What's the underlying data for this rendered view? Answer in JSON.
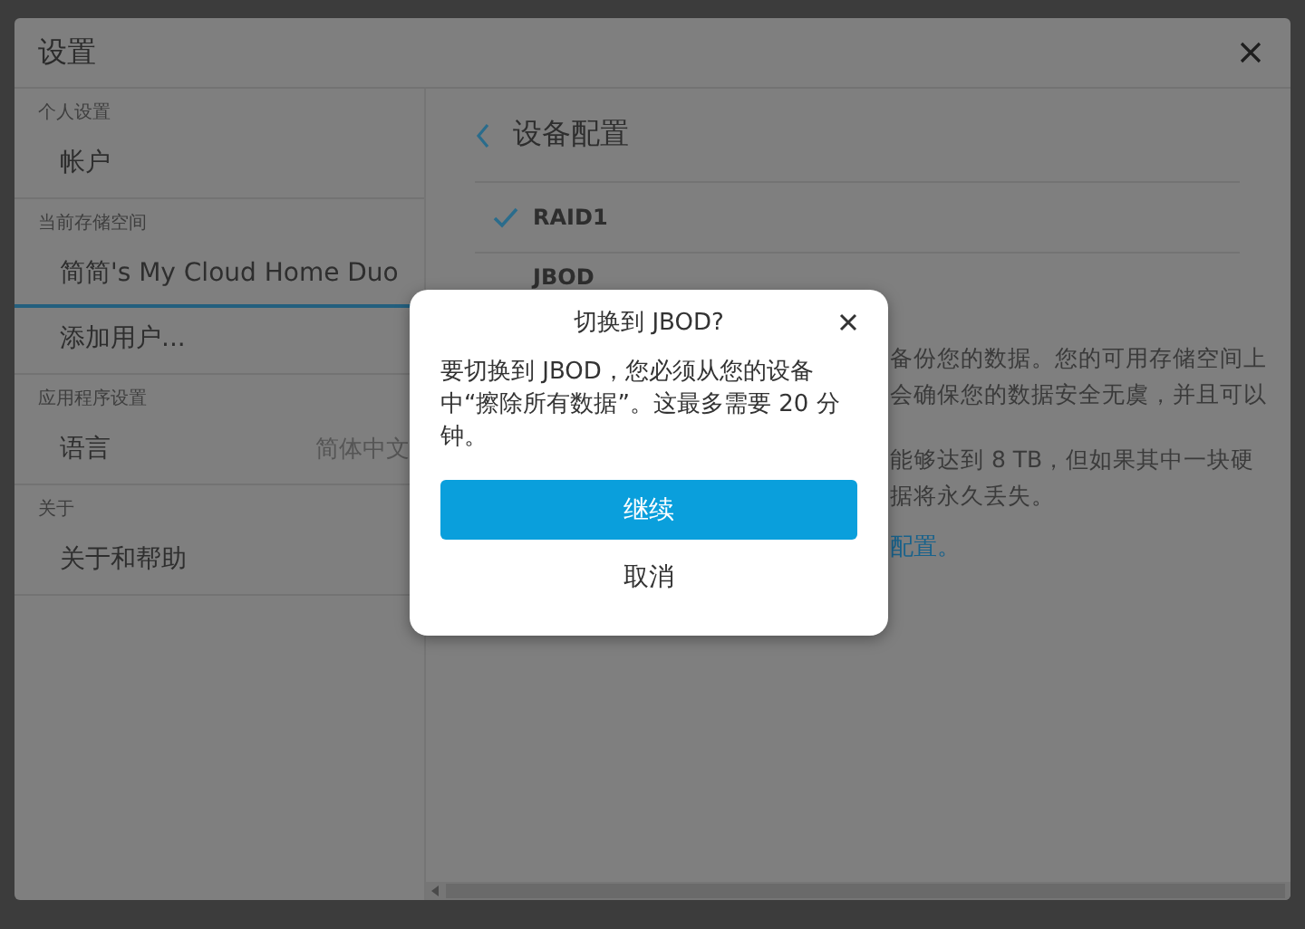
{
  "window": {
    "title": "设置"
  },
  "sidebar": {
    "sections": [
      {
        "heading": "个人设置",
        "items": [
          {
            "label": "帐户",
            "selected": false
          }
        ]
      },
      {
        "heading": "当前存储空间",
        "items": [
          {
            "label": "简简's My Cloud Home Duo",
            "selected": true
          },
          {
            "label": "添加用户...",
            "selected": false
          }
        ]
      },
      {
        "heading": "应用程序设置",
        "items": [
          {
            "label": "语言",
            "value": "简体中文",
            "selected": false
          }
        ]
      },
      {
        "heading": "关于",
        "items": [
          {
            "label": "关于和帮助",
            "selected": false
          }
        ]
      }
    ]
  },
  "panel": {
    "title": "设备配置",
    "options": [
      {
        "label": "RAID1",
        "checked": true
      },
      {
        "label": "JBOD",
        "checked": false
      }
    ],
    "paragraphs": [
      {
        "lines": [
          "备份您的数据。您的可用存储空间上",
          "会确保您的数据安全无虞，并且可以"
        ]
      },
      {
        "lines": [
          "能够达到 8 TB，但如果其中一块硬",
          "据将永久丢失。"
        ]
      }
    ],
    "link": "配置。"
  },
  "dialog": {
    "title": "切换到 JBOD?",
    "message": "要切换到 JBOD，您必须从您的设备中“擦除所有数据”。这最多需要 20 分钟。",
    "primary_button": "继续",
    "secondary_button": "取消"
  }
}
